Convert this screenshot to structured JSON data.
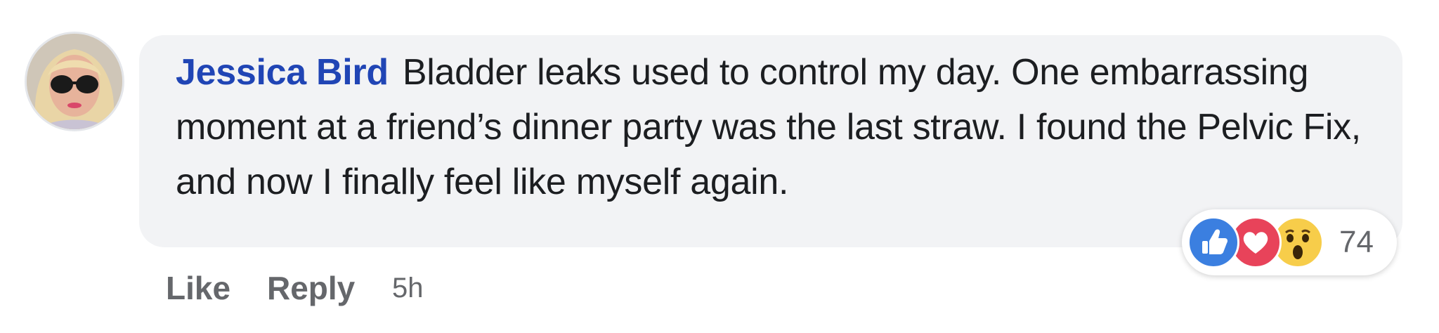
{
  "comment": {
    "author": "Jessica Bird",
    "text": "Bladder leaks used to control my day. One embarrassing moment at a friend’s dinner party was the last straw. I found the Pelvic Fix, and now I finally feel like myself again.",
    "reactions": {
      "icons": [
        "like-icon",
        "love-icon",
        "wow-icon"
      ],
      "count": "74"
    },
    "actions": {
      "like_label": "Like",
      "reply_label": "Reply",
      "timestamp": "5h"
    }
  },
  "colors": {
    "author": "#2045b5",
    "bubble": "#f2f3f5",
    "like": "#3b7fe0",
    "love": "#e8435a",
    "wow": "#f7cd4a",
    "meta": "#65676b"
  }
}
